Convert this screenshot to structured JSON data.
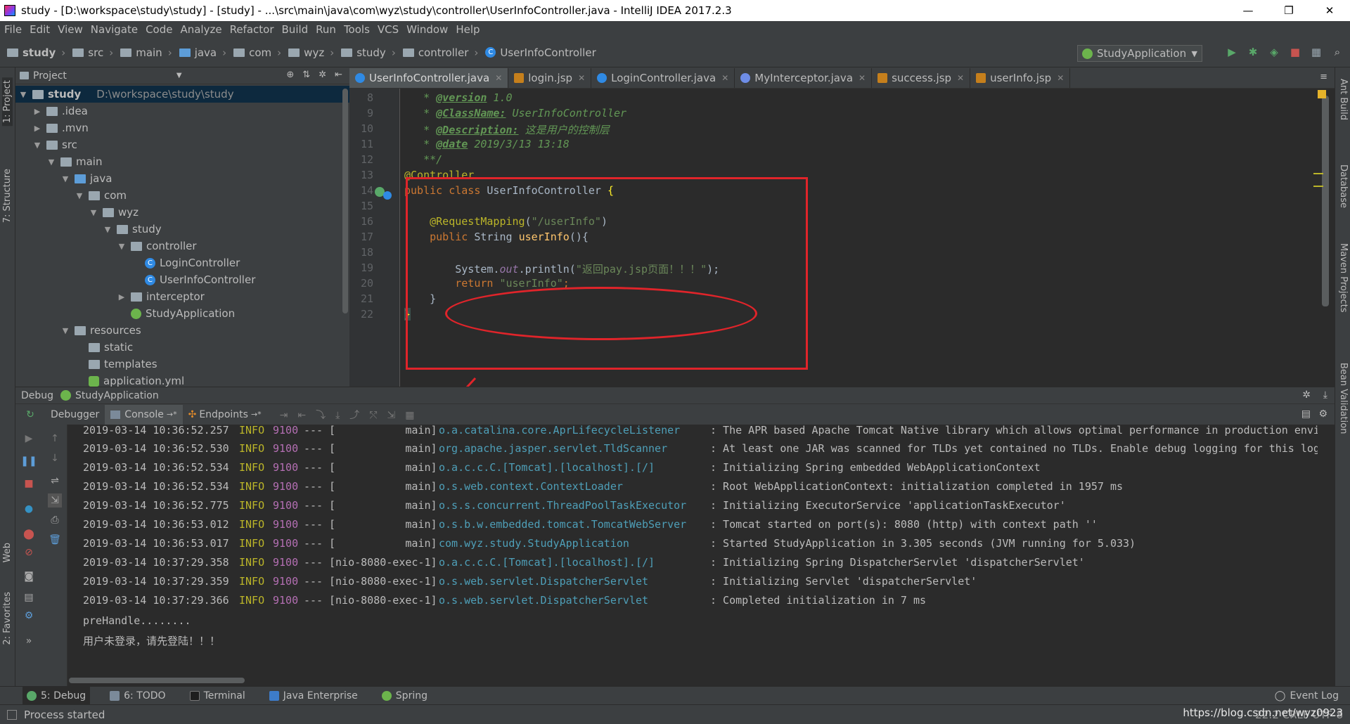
{
  "window": {
    "title": "study - [D:\\workspace\\study\\study] - [study] - ...\\src\\main\\java\\com\\wyz\\study\\controller\\UserInfoController.java - IntelliJ IDEA 2017.2.3",
    "minimize": "—",
    "restore": "❐",
    "close": "✕"
  },
  "menu": [
    "File",
    "Edit",
    "View",
    "Navigate",
    "Code",
    "Analyze",
    "Refactor",
    "Build",
    "Run",
    "Tools",
    "VCS",
    "Window",
    "Help"
  ],
  "breadcrumbs": [
    "study",
    "src",
    "main",
    "java",
    "com",
    "wyz",
    "study",
    "controller",
    "UserInfoController"
  ],
  "run_config": "StudyApplication",
  "left_strip": {
    "project": "1: Project",
    "structure": "7: Structure",
    "web": "Web",
    "favorites": "2: Favorites"
  },
  "right_strip": {
    "ant": "Ant Build",
    "database": "Database",
    "maven": "Maven Projects",
    "bean": "Bean Validation"
  },
  "project_panel": {
    "header": "Project",
    "tree": [
      {
        "label": "study",
        "extra": "D:\\workspace\\study\\study"
      },
      {
        "label": ".idea"
      },
      {
        "label": ".mvn"
      },
      {
        "label": "src"
      },
      {
        "label": "main"
      },
      {
        "label": "java"
      },
      {
        "label": "com"
      },
      {
        "label": "wyz"
      },
      {
        "label": "study"
      },
      {
        "label": "controller"
      },
      {
        "label": "LoginController"
      },
      {
        "label": "UserInfoController"
      },
      {
        "label": "interceptor"
      },
      {
        "label": "StudyApplication"
      },
      {
        "label": "resources"
      },
      {
        "label": "static"
      },
      {
        "label": "templates"
      },
      {
        "label": "application.yml"
      }
    ]
  },
  "editor_tabs": [
    "UserInfoController.java",
    "login.jsp",
    "LoginController.java",
    "MyInterceptor.java",
    "success.jsp",
    "userInfo.jsp"
  ],
  "line_numbers": [
    "8",
    "9",
    "10",
    "11",
    "12",
    "13",
    "14",
    "15",
    "16",
    "17",
    "18",
    "19",
    "20",
    "21",
    "22"
  ],
  "code": {
    "l8_tag": "@version",
    "l8_text": " 1.0",
    "l9_tag": "@ClassName:",
    "l9_text": " UserInfoController",
    "l10_tag": "@Description:",
    "l10_text": " 这是用户的控制层",
    "l11_tag": "@date",
    "l11_text": " 2019/3/13 13:18",
    "l12": "**/",
    "l13": "@Controller",
    "l14_kw": "public class ",
    "l14_name": "UserInfoController ",
    "l14_brace": "{",
    "l16_ann": "@RequestMapping",
    "l16_p1": "(",
    "l16_str": "\"/userInfo\"",
    "l16_p2": ")",
    "l17_kw": "public ",
    "l17_type": "String ",
    "l17_fn": "userInfo",
    "l17_rest": "(){",
    "l19_a": "System.",
    "l19_out": "out",
    "l19_b": ".println(",
    "l19_str": "\"返回pay.jsp页面！！！\"",
    "l19_c": ");",
    "l20_kw": "return ",
    "l20_str": "\"userInfo\"",
    "l20_c": ";",
    "l21": "}",
    "l22": "}"
  },
  "debug": {
    "header_label": "Debug",
    "header_config": "StudyApplication",
    "tabs": [
      "Debugger",
      "Console",
      "Endpoints"
    ],
    "log": [
      {
        "ts": "2019-03-14 10:36:52.257",
        "lvl": "INFO",
        "pid": "9100",
        "dash": "---",
        "th": "[           main]",
        "lg": "o.a.catalina.core.AprLifecycleListener",
        "msg": ": The APR based Apache Tomcat Native library which allows optimal performance in production environ"
      },
      {
        "ts": "2019-03-14 10:36:52.530",
        "lvl": "INFO",
        "pid": "9100",
        "dash": "---",
        "th": "[           main]",
        "lg": "org.apache.jasper.servlet.TldScanner",
        "msg": ": At least one JAR was scanned for TLDs yet contained no TLDs. Enable debug logging for this logger"
      },
      {
        "ts": "2019-03-14 10:36:52.534",
        "lvl": "INFO",
        "pid": "9100",
        "dash": "---",
        "th": "[           main]",
        "lg": "o.a.c.c.C.[Tomcat].[localhost].[/]",
        "msg": ": Initializing Spring embedded WebApplicationContext"
      },
      {
        "ts": "2019-03-14 10:36:52.534",
        "lvl": "INFO",
        "pid": "9100",
        "dash": "---",
        "th": "[           main]",
        "lg": "o.s.web.context.ContextLoader",
        "msg": ": Root WebApplicationContext: initialization completed in 1957 ms"
      },
      {
        "ts": "2019-03-14 10:36:52.775",
        "lvl": "INFO",
        "pid": "9100",
        "dash": "---",
        "th": "[           main]",
        "lg": "o.s.s.concurrent.ThreadPoolTaskExecutor",
        "msg": ": Initializing ExecutorService 'applicationTaskExecutor'"
      },
      {
        "ts": "2019-03-14 10:36:53.012",
        "lvl": "INFO",
        "pid": "9100",
        "dash": "---",
        "th": "[           main]",
        "lg": "o.s.b.w.embedded.tomcat.TomcatWebServer",
        "msg": ": Tomcat started on port(s): 8080 (http) with context path ''"
      },
      {
        "ts": "2019-03-14 10:36:53.017",
        "lvl": "INFO",
        "pid": "9100",
        "dash": "---",
        "th": "[           main]",
        "lg": "com.wyz.study.StudyApplication",
        "msg": ": Started StudyApplication in 3.305 seconds (JVM running for 5.033)"
      },
      {
        "ts": "2019-03-14 10:37:29.358",
        "lvl": "INFO",
        "pid": "9100",
        "dash": "---",
        "th": "[nio-8080-exec-1]",
        "lg": "o.a.c.c.C.[Tomcat].[localhost].[/]",
        "msg": ": Initializing Spring DispatcherServlet 'dispatcherServlet'"
      },
      {
        "ts": "2019-03-14 10:37:29.359",
        "lvl": "INFO",
        "pid": "9100",
        "dash": "---",
        "th": "[nio-8080-exec-1]",
        "lg": "o.s.web.servlet.DispatcherServlet",
        "msg": ": Initializing Servlet 'dispatcherServlet'"
      },
      {
        "ts": "2019-03-14 10:37:29.366",
        "lvl": "INFO",
        "pid": "9100",
        "dash": "---",
        "th": "[nio-8080-exec-1]",
        "lg": "o.s.web.servlet.DispatcherServlet",
        "msg": ": Completed initialization in 7 ms"
      }
    ],
    "output": [
      "preHandle........",
      "用户未登录，请先登陆！！！"
    ]
  },
  "bottom_tools": [
    "5: Debug",
    "6: TODO",
    "Terminal",
    "Java Enterprise",
    "Spring"
  ],
  "event_log": "Event Log",
  "status": {
    "message": "Process started",
    "right": "22:2  CRLF  UTF-8",
    "watermark": "https://blog.csdn.net/wyz0923"
  },
  "colors": {
    "annotation_red": "#e0242a",
    "editor_bg": "#2b2b2b",
    "panel_bg": "#3c3f41"
  }
}
